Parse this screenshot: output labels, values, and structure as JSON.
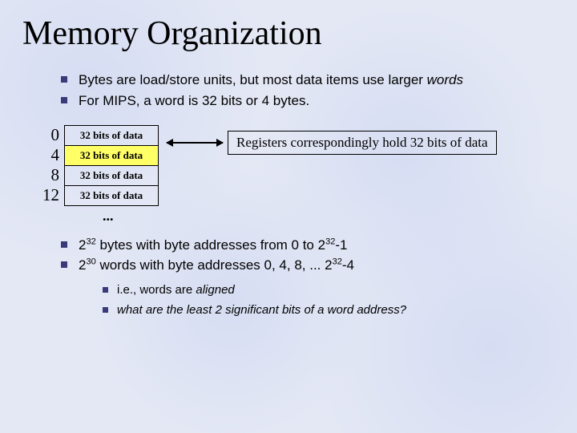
{
  "title": "Memory Organization",
  "bullets_top": {
    "b1_pre": "Bytes are load/store units, but most data items use larger ",
    "b1_italic": "words",
    "b2": "For MIPS, a word is 32 bits or 4 bytes."
  },
  "memory": {
    "rows": [
      {
        "addr": "0",
        "content": "32 bits of data"
      },
      {
        "addr": "4",
        "content": "32 bits of data"
      },
      {
        "addr": "8",
        "content": "32 bits of data"
      },
      {
        "addr": "12",
        "content": "32 bits of data"
      }
    ],
    "ellipsis": "...",
    "register_note": "Registers correspondingly hold 32 bits of data"
  },
  "bullets_bottom": {
    "b1_a": "2",
    "b1_b": "32",
    "b1_c": " bytes with byte addresses from 0 to 2",
    "b1_d": "32",
    "b1_e": "-1",
    "b2_a": "2",
    "b2_b": "30",
    "b2_c": " words with byte addresses 0, 4, 8, ... 2",
    "b2_d": "32",
    "b2_e": "-4"
  },
  "sub": {
    "s1_pre": "i.e., words are ",
    "s1_italic": "aligned",
    "s2": "what are the least 2 significant bits of a word address?"
  }
}
